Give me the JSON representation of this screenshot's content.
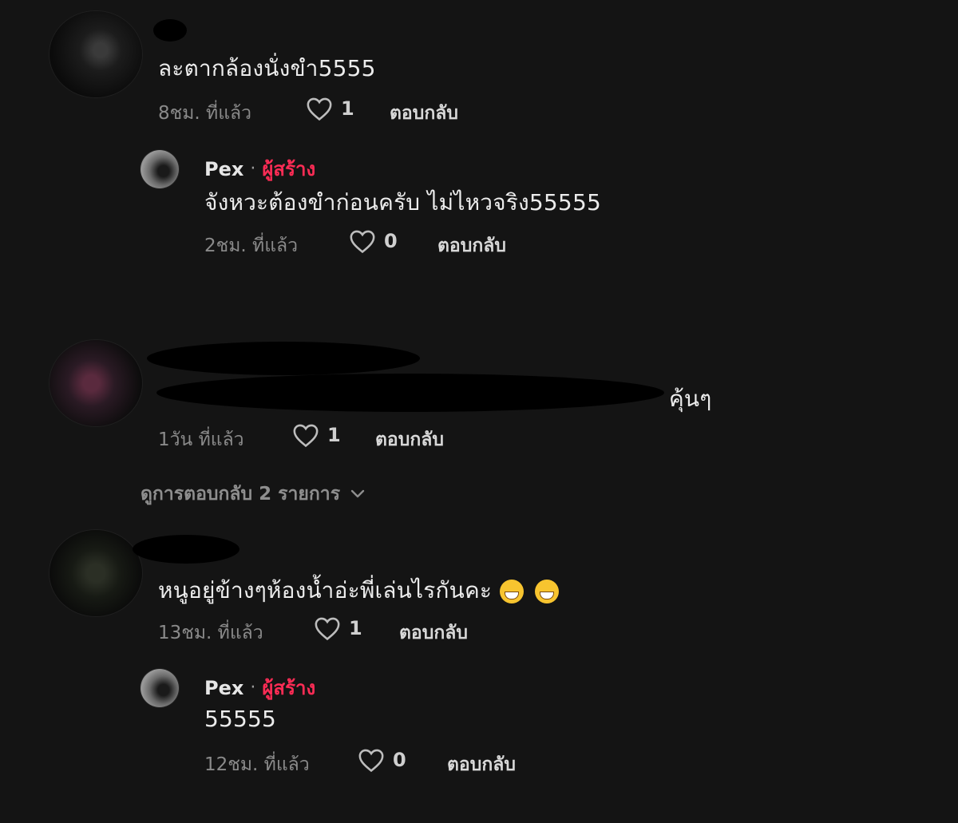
{
  "comments": [
    {
      "text": "ละตากล้องนั่งขำ5555",
      "time": "8ชม. ที่แล้ว",
      "likes": "1",
      "reply_label": "ตอบกลับ",
      "replies": [
        {
          "author": "Pex",
          "separator": "·",
          "badge": "ผู้สร้าง",
          "text": "จังหวะต้องขำก่อนครับ ไม่ไหวจริง55555",
          "time": "2ชม. ที่แล้ว",
          "likes": "0",
          "reply_label": "ตอบกลับ"
        }
      ]
    },
    {
      "text_visible_suffix": "คุ้นๆ",
      "time": "1วัน ที่แล้ว",
      "likes": "1",
      "reply_label": "ตอบกลับ",
      "view_replies": "ดูการตอบกลับ 2 รายการ"
    },
    {
      "text": "หนูอยู่ข้างๆห้องน้ำอ่ะพี่เล่นไรกันคะ",
      "emojis": [
        "grinning-sweat-emoji",
        "grinning-sweat-emoji"
      ],
      "time": "13ชม. ที่แล้ว",
      "likes": "1",
      "reply_label": "ตอบกลับ",
      "replies": [
        {
          "author": "Pex",
          "separator": "·",
          "badge": "ผู้สร้าง",
          "text": "55555",
          "time": "12ชม. ที่แล้ว",
          "likes": "0",
          "reply_label": "ตอบกลับ"
        }
      ]
    }
  ],
  "colors": {
    "background": "#141414",
    "creator_badge": "#fe2c55",
    "meta_text": "#8a8a8a"
  }
}
